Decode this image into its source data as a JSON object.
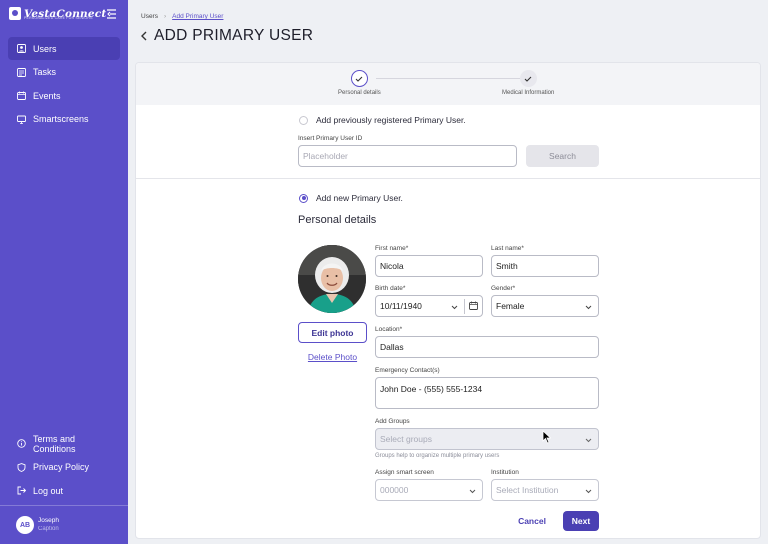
{
  "app": {
    "brand": "VestaConnect",
    "brand_tagline": "PERSONALIZED CARE FOR SENIORS"
  },
  "sidebar": {
    "items": [
      {
        "label": "Users",
        "icon": "users-icon",
        "active": true
      },
      {
        "label": "Tasks",
        "icon": "tasks-icon"
      },
      {
        "label": "Events",
        "icon": "calendar-icon"
      },
      {
        "label": "Smartscreens",
        "icon": "monitor-icon"
      }
    ],
    "bottom_items": [
      {
        "label": "Terms and Conditions",
        "icon": "info-icon"
      },
      {
        "label": "Privacy Policy",
        "icon": "shield-icon"
      },
      {
        "label": "Log out",
        "icon": "logout-icon"
      }
    ],
    "user": {
      "initials": "AB",
      "name": "Joseph",
      "caption": "Caption"
    }
  },
  "breadcrumb": {
    "root": "Users",
    "current": "Add Primary User"
  },
  "page": {
    "title": "ADD PRIMARY USER"
  },
  "stepper": {
    "steps": [
      {
        "label": "Personal details",
        "state": "current"
      },
      {
        "label": "Medical Information",
        "state": "upcoming"
      }
    ]
  },
  "existing_user": {
    "option_label": "Add previously registered Primary User.",
    "id_label": "Insert Primary User ID",
    "id_placeholder": "Placeholder",
    "search_label": "Search"
  },
  "new_user": {
    "option_label": "Add new Primary User.",
    "section_title": "Personal details",
    "edit_photo": "Edit photo",
    "delete_photo": "Delete Photo",
    "fields": {
      "first_name": {
        "label": "First name*",
        "value": "Nicola"
      },
      "last_name": {
        "label": "Last name*",
        "value": "Smith"
      },
      "birth_date": {
        "label": "Birth date*",
        "value": "10/11/1940"
      },
      "gender": {
        "label": "Gender*",
        "value": "Female"
      },
      "location": {
        "label": "Location*",
        "value": "Dallas"
      },
      "emergency": {
        "label": "Emergency Contact(s)",
        "value": "John Doe - (555) 555-1234"
      },
      "groups": {
        "label": "Add Groups",
        "placeholder": "Select groups",
        "helper": "Groups help to organize multiple primary users"
      },
      "smart_screen": {
        "label": "Assign smart screen",
        "placeholder": "000000"
      },
      "institution": {
        "label": "Institution",
        "placeholder": "Select Institution"
      }
    }
  },
  "actions": {
    "cancel": "Cancel",
    "next": "Next"
  },
  "colors": {
    "primary": "#5b4fc9",
    "primary_dark": "#4a3fb3",
    "background": "#eef0f4"
  }
}
